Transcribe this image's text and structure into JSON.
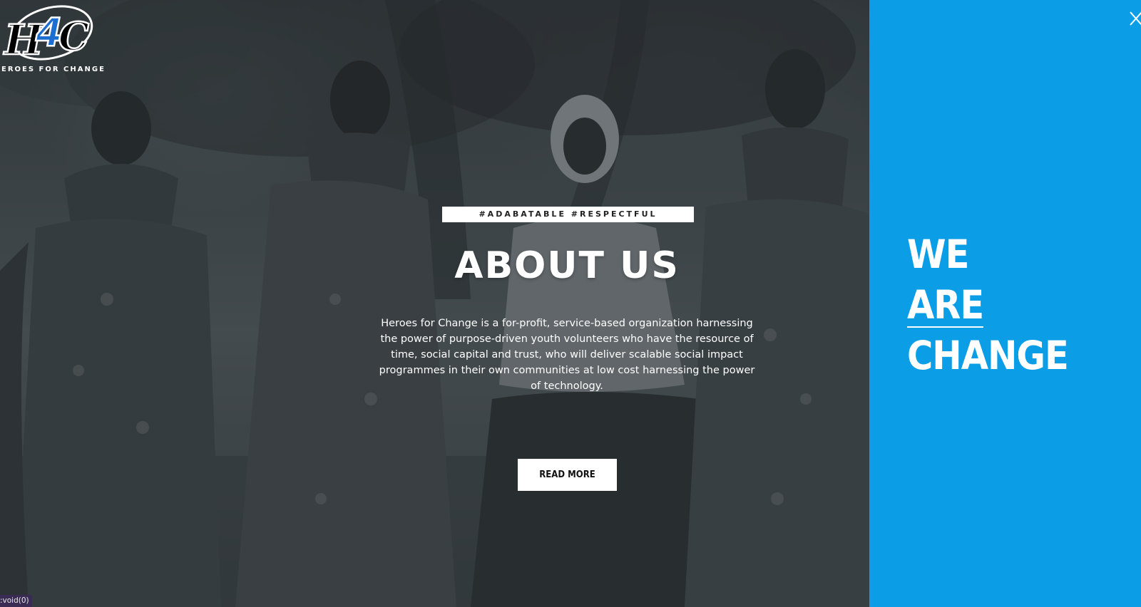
{
  "brand": {
    "logo_text": "H4C",
    "name": "EROES FOR CHANGE"
  },
  "hero": {
    "tagline": "#ADABATABLE #RESPECTFUL",
    "title": "ABOUT US",
    "description": "Heroes for Change is a for-profit, service-based organization harnessing the power of purpose-driven youth volunteers who have the resource of time, social capital and trust, who will deliver scalable social impact programmes in their own communities at low cost harnessing the power of technology.",
    "cta_label": "READ MORE"
  },
  "side_panel": {
    "slogan": [
      "WE",
      "ARE",
      "CHANGE"
    ],
    "close_icon": "close-icon"
  },
  "status_bar": {
    "link": ":void(0)"
  },
  "colors": {
    "panel_blue": "#0b9ee6",
    "logo_blue": "#1c6fd1",
    "status_purple": "#3a2b55"
  }
}
